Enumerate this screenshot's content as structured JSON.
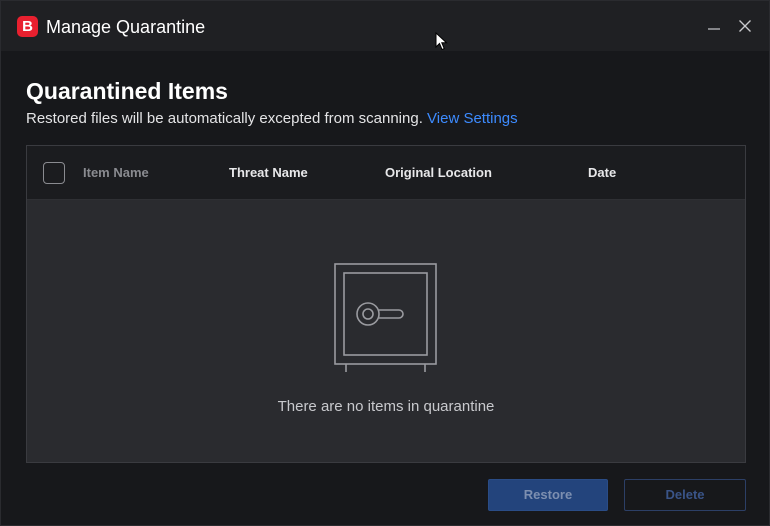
{
  "window": {
    "title": "Manage Quarantine",
    "logo_letter": "B",
    "brand_color": "#e8202f"
  },
  "content": {
    "heading": "Quarantined Items",
    "description": "Restored files will be automatically excepted from scanning.",
    "link_label": "View Settings",
    "accent_color": "#3d8bff"
  },
  "table": {
    "columns": [
      "Item Name",
      "Threat Name",
      "Original Location",
      "Date"
    ],
    "select_all_checked": false,
    "rows": [],
    "empty_message": "There are no items in quarantine",
    "empty_icon": "safe-vault-icon"
  },
  "actions": {
    "restore_label": "Restore",
    "delete_label": "Delete"
  }
}
